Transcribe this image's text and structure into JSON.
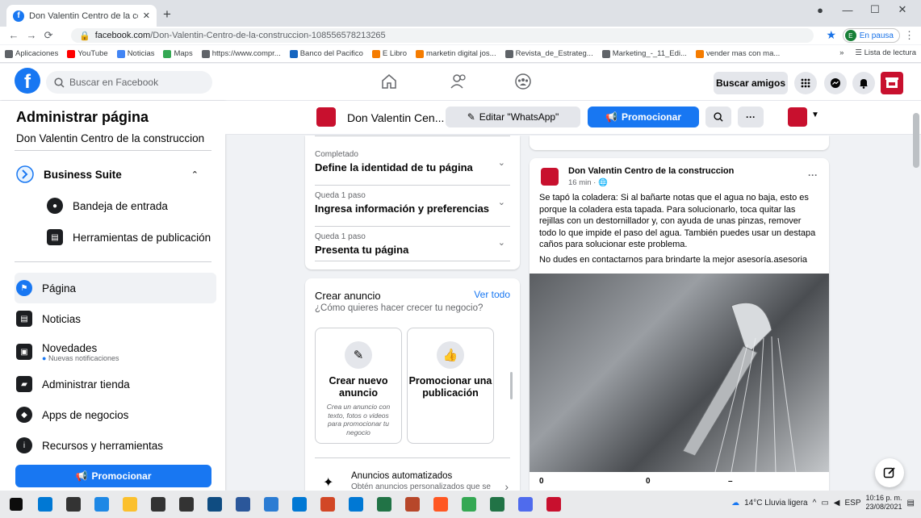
{
  "browser": {
    "tab_title": "Don Valentin Centro de la constr...",
    "url_host": "facebook.com",
    "url_path": "/Don-Valentin-Centro-de-la-construccion-108556578213265",
    "profile_initial": "E",
    "profile_status": "En pausa",
    "bookmarks": [
      {
        "label": "Aplicaciones",
        "color": "#5f6368"
      },
      {
        "label": "YouTube",
        "color": "#ff0000"
      },
      {
        "label": "Noticias",
        "color": "#4285f4"
      },
      {
        "label": "Maps",
        "color": "#34a853"
      },
      {
        "label": "https://www.compr...",
        "color": "#5f6368"
      },
      {
        "label": "Banco del Pacifico",
        "color": "#1565c0"
      },
      {
        "label": "E Libro",
        "color": "#f57c00"
      },
      {
        "label": "marketin digital jos...",
        "color": "#f57c00"
      },
      {
        "label": "Revista_de_Estrateg...",
        "color": "#5f6368"
      },
      {
        "label": "Marketing_-_11_Edi...",
        "color": "#5f6368"
      },
      {
        "label": "vender mas con ma...",
        "color": "#f57c00"
      }
    ],
    "reading_list": "Lista de lectura",
    "more_bookmarks": "»"
  },
  "fb": {
    "logo": "f",
    "search_placeholder": "Buscar en Facebook",
    "find_friends": "Buscar amigos"
  },
  "sidebar": {
    "title": "Administrar página",
    "page_name": "Don Valentin Centro de la construccion",
    "business_suite": "Business Suite",
    "sub_items": [
      "Bandeja de entrada",
      "Herramientas de publicación"
    ],
    "items": [
      {
        "label": "Página",
        "icon": "flag-icon"
      },
      {
        "label": "Noticias",
        "icon": "news-icon"
      },
      {
        "label": "Novedades",
        "icon": "bell-icon",
        "note": "Nuevas notificaciones"
      },
      {
        "label": "Administrar tienda",
        "icon": "shop-icon"
      },
      {
        "label": "Apps de negocios",
        "icon": "cube-icon"
      },
      {
        "label": "Recursos y herramientas",
        "icon": "info-icon"
      }
    ],
    "promote": "Promocionar"
  },
  "page_header": {
    "name": "Don Valentin Cen...",
    "edit_button": "Editar \"WhatsApp\"",
    "promote_button": "Promocionar",
    "more": "···"
  },
  "setup": {
    "steps": [
      {
        "status": "Completado",
        "title": "Define la identidad de tu página"
      },
      {
        "status": "Queda 1 paso",
        "title": "Ingresa información y preferencias"
      },
      {
        "status": "Queda 1 paso",
        "title": "Presenta tu página"
      }
    ]
  },
  "ads": {
    "title": "Crear anuncio",
    "see_all": "Ver todo",
    "subtitle": "¿Cómo quieres hacer crecer tu negocio?",
    "options": [
      {
        "title": "Crear nuevo anuncio",
        "desc": "Crea un anuncio con texto, fotos o videos para promocionar tu negocio",
        "icon": "edit-icon"
      },
      {
        "title": "Promocionar una publicación",
        "desc": "",
        "icon": "thumbs-up-icon"
      }
    ],
    "auto_title": "Anuncios automatizados",
    "auto_desc": "Obtén anuncios personalizados que se"
  },
  "post": {
    "author": "Don Valentin Centro de la construccion",
    "time": "16 min · ",
    "text": "Se tapó la coladera: Si al bañarte notas que el agua no baja, esto es porque la coladera esta tapada. Para solucionarlo, toca quitar las rejillas con un destornillador y, con ayuda de unas pinzas, remover todo lo que impide el paso del agua. También puedes usar un destapa caños para solucionar este problema.",
    "text2": "No dudes en contactarnos para brindarte la mejor asesoría.asesoria",
    "more": "···",
    "stats": [
      "0",
      "0",
      "–"
    ]
  },
  "taskbar": {
    "weather": "14°C  Lluvia ligera",
    "lang": "ESP",
    "time": "10:16 p. m.",
    "date": "23/08/2021",
    "apps": [
      "#0078d4",
      "#333",
      "#1e88e5",
      "#fbc02d",
      "#333",
      "#333",
      "#0f4c81",
      "#2b579a",
      "#2b7cd3",
      "#0078d4",
      "#d24726",
      "#0078d4",
      "#217346",
      "#b7472a",
      "#ff5722",
      "#34a853",
      "#217346",
      "#4f6bed",
      "#c8102e"
    ]
  }
}
